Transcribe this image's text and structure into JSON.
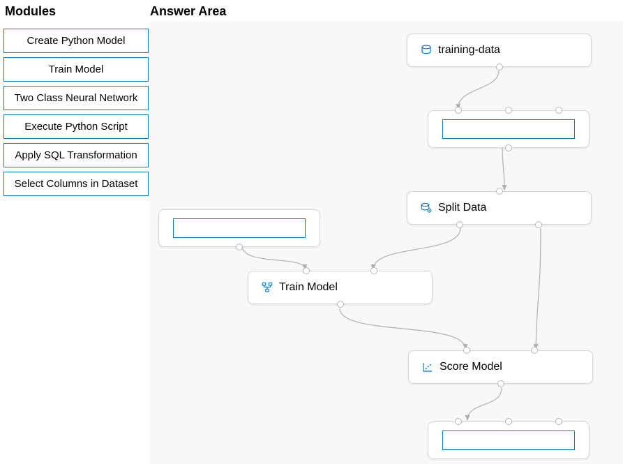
{
  "modules": {
    "title": "Modules",
    "items": [
      "Create Python Model",
      "Train Model",
      "Two Class Neural Network",
      "Execute Python Script",
      "Apply SQL Transformation",
      "Select Columns in Dataset"
    ]
  },
  "answer": {
    "title": "Answer Area",
    "nodes": {
      "training_data": "training-data",
      "split_data": "Split Data",
      "train_model": "Train Model",
      "score_model": "Score Model"
    }
  }
}
